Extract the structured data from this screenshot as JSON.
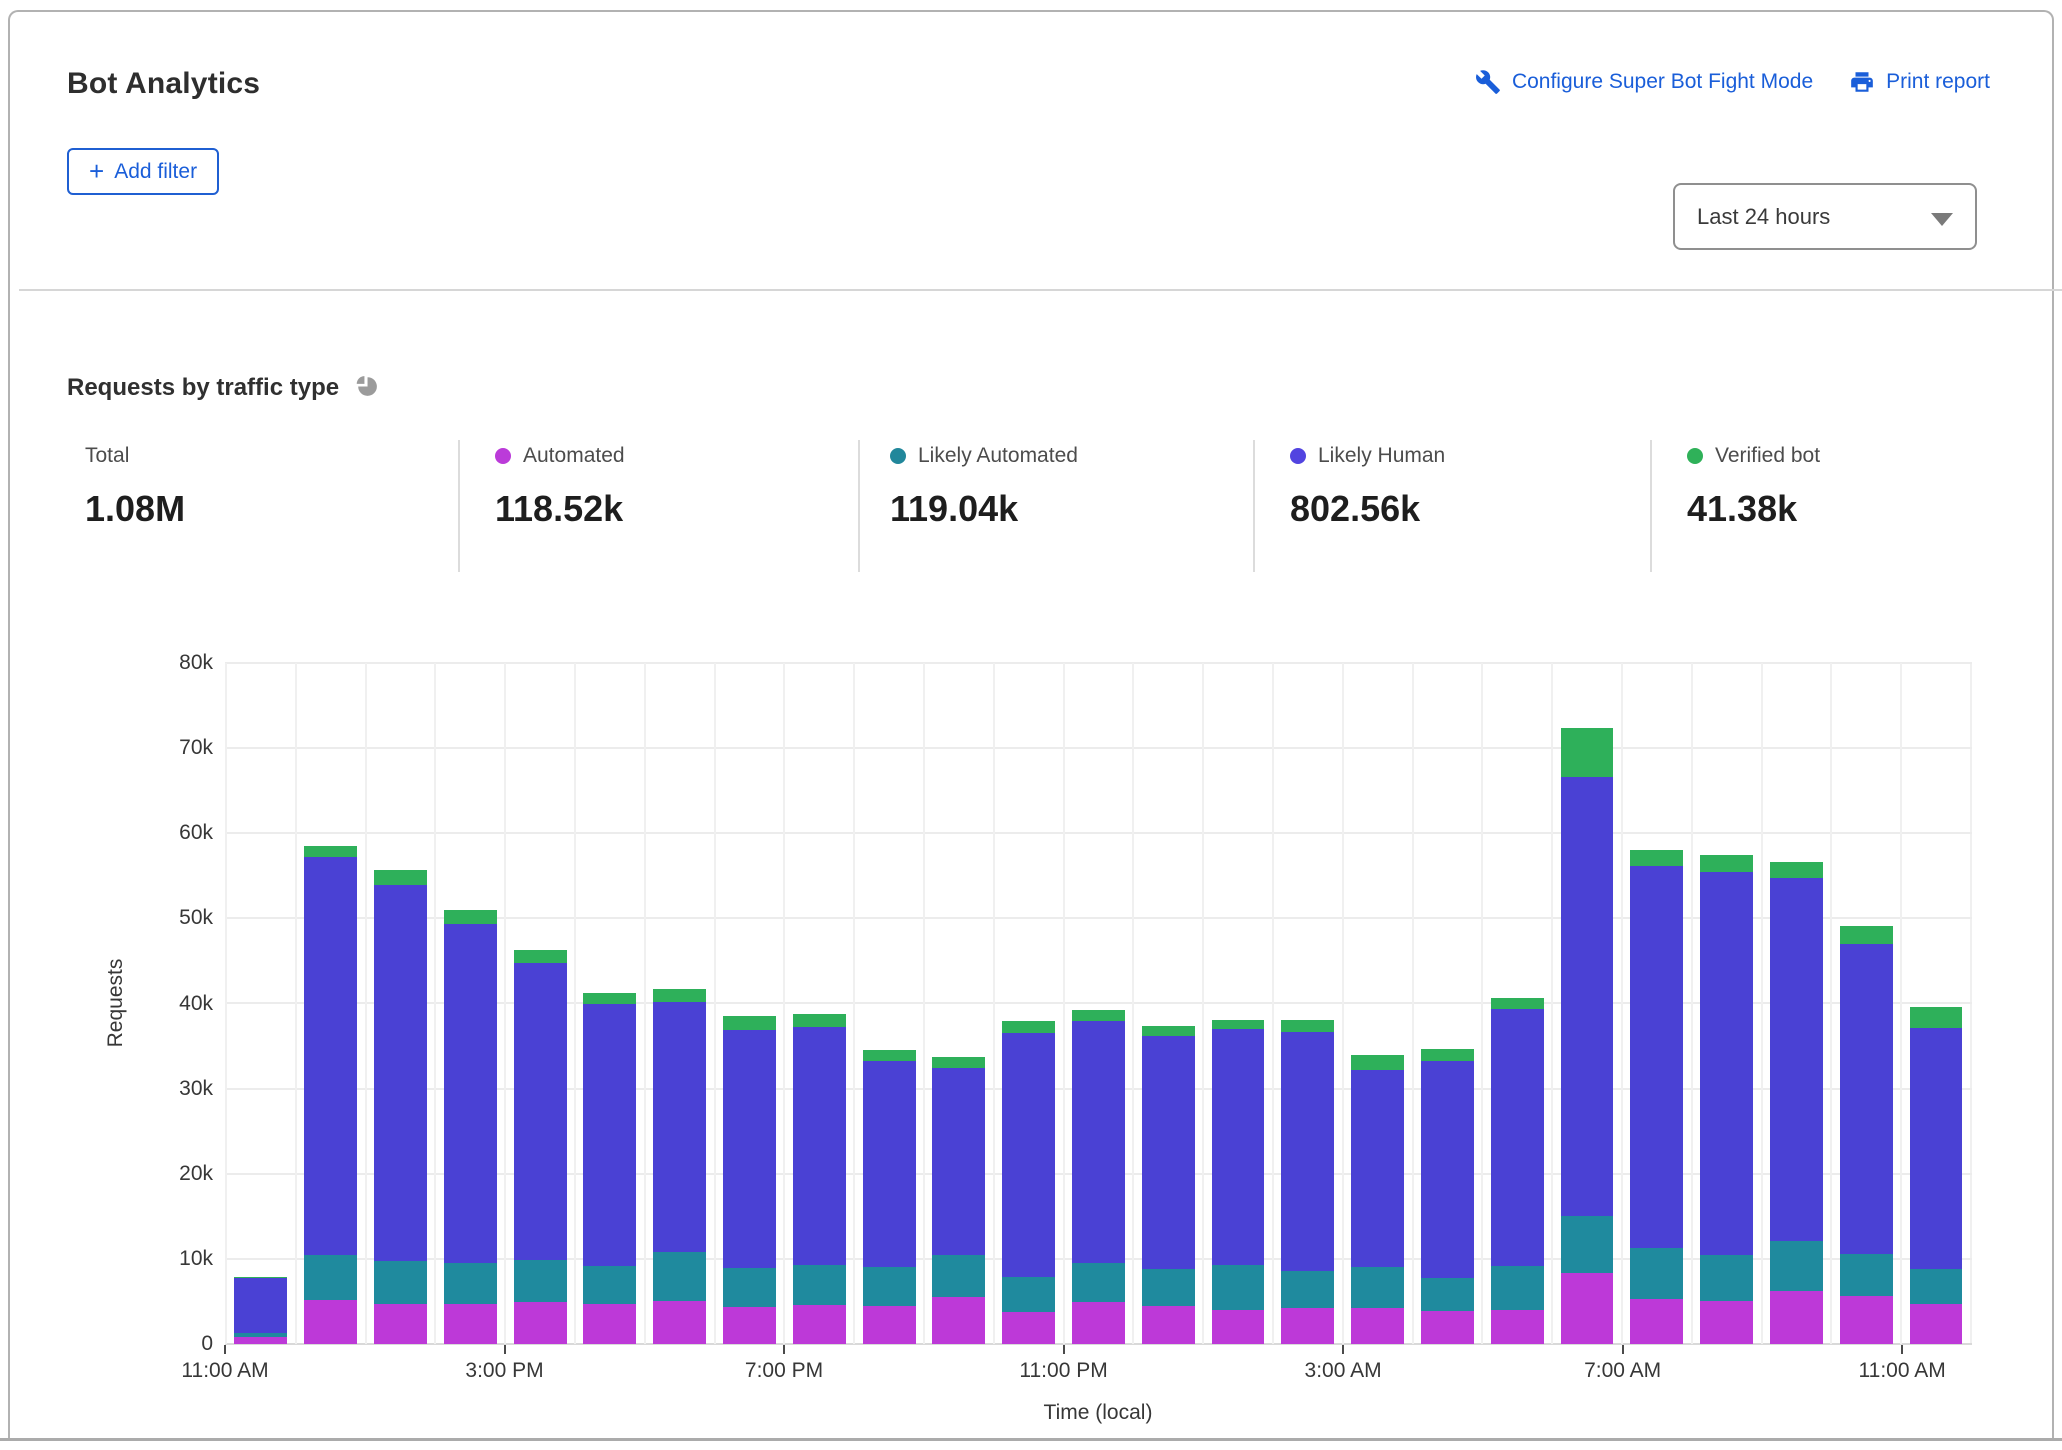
{
  "header": {
    "title": "Bot Analytics",
    "configure_link": "Configure Super Bot Fight Mode",
    "print_link": "Print report",
    "add_filter_plus": "+",
    "add_filter_label": "Add filter",
    "time_range_value": "Last 24 hours"
  },
  "section": {
    "title": "Requests by traffic type",
    "stats": [
      {
        "label": "Total",
        "value": "1.08M",
        "color": null
      },
      {
        "label": "Automated",
        "value": "118.52k",
        "color": "#bb3bd9"
      },
      {
        "label": "Likely Automated",
        "value": "119.04k",
        "color": "#21879b"
      },
      {
        "label": "Likely Human",
        "value": "802.56k",
        "color": "#5244e0"
      },
      {
        "label": "Verified bot",
        "value": "41.38k",
        "color": "#2fb159"
      }
    ]
  },
  "colors": {
    "accent_blue": "#1a5ed9",
    "grid": "#ececec",
    "pie_icon_gray": "#9b9b9b"
  },
  "chart_data": {
    "type": "bar",
    "stacked": true,
    "title": "Requests by traffic type",
    "xlabel": "Time (local)",
    "ylabel": "Requests",
    "ylim": [
      0,
      80000
    ],
    "grid": true,
    "num_bars": 25,
    "y_ticks": [
      "0",
      "10k",
      "20k",
      "30k",
      "40k",
      "50k",
      "60k",
      "70k",
      "80k"
    ],
    "x_ticks": [
      {
        "index": 0,
        "label": "11:00 AM"
      },
      {
        "index": 4,
        "label": "3:00 PM"
      },
      {
        "index": 8,
        "label": "7:00 PM"
      },
      {
        "index": 12,
        "label": "11:00 PM"
      },
      {
        "index": 16,
        "label": "3:00 AM"
      },
      {
        "index": 20,
        "label": "7:00 AM"
      },
      {
        "index": 24,
        "label": "11:00 AM"
      }
    ],
    "series": [
      {
        "name": "Automated",
        "color": "#bd39d8",
        "values": [
          800,
          5200,
          4700,
          4700,
          4900,
          4700,
          5000,
          4300,
          4600,
          4500,
          5500,
          3800,
          4900,
          4500,
          4000,
          4200,
          4200,
          3900,
          4000,
          8300,
          5300,
          5100,
          6200,
          5600,
          4700
        ]
      },
      {
        "name": "Likely Automated",
        "color": "#1f8a9e",
        "values": [
          500,
          5200,
          5000,
          4800,
          5000,
          4500,
          5800,
          4600,
          4700,
          4500,
          5000,
          4100,
          4600,
          4300,
          5300,
          4400,
          4800,
          3900,
          5200,
          6700,
          6000,
          5400,
          5900,
          5000,
          4100
        ]
      },
      {
        "name": "Likely Human",
        "color": "#4a41d4",
        "values": [
          6400,
          46800,
          44200,
          39800,
          34900,
          30700,
          29400,
          28000,
          28000,
          24300,
          21900,
          28700,
          28500,
          27400,
          27700,
          28000,
          23200,
          25500,
          30100,
          51600,
          44800,
          44900,
          42600,
          36400,
          28300
        ]
      },
      {
        "name": "Verified bot",
        "color": "#2eb05a",
        "values": [
          200,
          1300,
          1800,
          1700,
          1500,
          1300,
          1500,
          1600,
          1500,
          1200,
          1300,
          1300,
          1200,
          1200,
          1100,
          1500,
          1800,
          1400,
          1400,
          5800,
          1900,
          2100,
          1900,
          2100,
          2500
        ]
      }
    ]
  }
}
